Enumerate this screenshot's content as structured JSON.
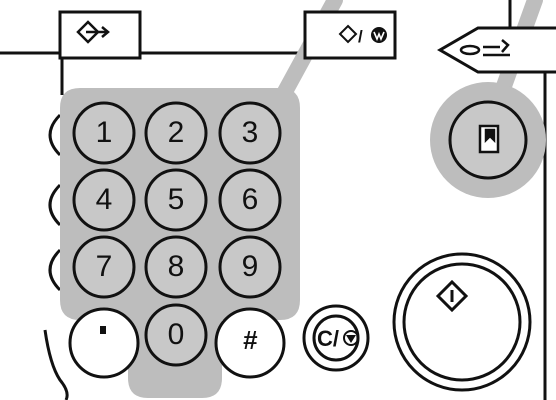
{
  "keypad": {
    "keys": [
      {
        "name": "key-1",
        "label": "1"
      },
      {
        "name": "key-2",
        "label": "2"
      },
      {
        "name": "key-3",
        "label": "3"
      },
      {
        "name": "key-4",
        "label": "4"
      },
      {
        "name": "key-5",
        "label": "5"
      },
      {
        "name": "key-6",
        "label": "6"
      },
      {
        "name": "key-7",
        "label": "7"
      },
      {
        "name": "key-8",
        "label": "8"
      },
      {
        "name": "key-9",
        "label": "9"
      },
      {
        "name": "key-0",
        "label": "0"
      }
    ],
    "hash_label": "#"
  },
  "clear_stop": {
    "label": "C/",
    "icon": "stop-icon"
  },
  "start": {
    "icon": "start-icon"
  },
  "top_buttons": {
    "left_icon": "login-arrow-icon",
    "middle_label": "/",
    "middle_icons": [
      "clear-modes-icon",
      "energy-saver-icon"
    ],
    "right_icon": "program-icon"
  },
  "interrupt": {
    "icon": "interrupt-icon"
  },
  "colors": {
    "highlight": "#bdbdbd",
    "key_fill": "#c8c8c8",
    "outline": "#111111"
  }
}
